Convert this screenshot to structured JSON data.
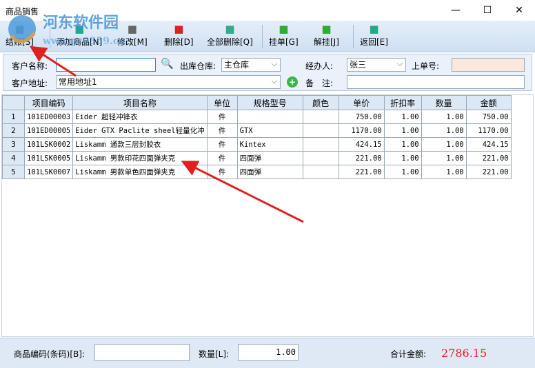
{
  "window": {
    "title": "商品销售",
    "minimize": "—",
    "maximize": "☐",
    "close": "✕"
  },
  "watermark": {
    "text": "河东软件园",
    "url": "www.pc0359.cn"
  },
  "toolbar": [
    {
      "label": "结账[S]",
      "icon": "save-icon",
      "color": "#8aa"
    },
    {
      "label": "添加商品[N]",
      "icon": "add-item-icon",
      "color": "#2a8"
    },
    {
      "label": "修改[M]",
      "icon": "edit-icon",
      "color": "#666"
    },
    {
      "label": "删除[D]",
      "icon": "delete-icon",
      "color": "#e02020"
    },
    {
      "label": "全部删除[Q]",
      "icon": "delete-all-icon",
      "color": "#3a8"
    },
    {
      "label": "挂单[G]",
      "icon": "hold-icon",
      "color": "#3a3"
    },
    {
      "label": "解挂[J]",
      "icon": "unhold-icon",
      "color": "#3a3"
    },
    {
      "label": "返回[E]",
      "icon": "exit-icon",
      "color": "#2a8"
    }
  ],
  "form": {
    "customer_name_label": "客户名称:",
    "customer_name": "",
    "warehouse_label": "出库仓库:",
    "warehouse": "主仓库",
    "handler_label": "经办人:",
    "handler": "张三",
    "prev_order_label": "上单号:",
    "prev_order": "",
    "address_label": "客户地址:",
    "address": "常用地址1",
    "remark_label": "备　注:",
    "remark": ""
  },
  "table": {
    "columns": [
      "",
      "项目编码",
      "项目名称",
      "单位",
      "规格型号",
      "颜色",
      "单价",
      "折扣率",
      "数量",
      "金额"
    ],
    "rows": [
      [
        "1",
        "101ED00003",
        "Eider 超轻冲锋衣",
        "件",
        "",
        "",
        "750.00",
        "1.00",
        "1.00",
        "750.00"
      ],
      [
        "2",
        "101ED00005",
        "Eider GTX Paclite sheel轻量化冲",
        "件",
        "GTX",
        "",
        "1170.00",
        "1.00",
        "1.00",
        "1170.00"
      ],
      [
        "3",
        "101LSK0002",
        "Liskamm 通款三层封胶衣",
        "件",
        "Kintex",
        "",
        "424.15",
        "1.00",
        "1.00",
        "424.15"
      ],
      [
        "4",
        "101LSK0005",
        "Liskamm 男款印花四面弹夹克",
        "件",
        "四面弹",
        "",
        "221.00",
        "1.00",
        "1.00",
        "221.00"
      ],
      [
        "5",
        "101LSK0007",
        "Liskamm 男款单色四面弹夹克",
        "件",
        "四面弹",
        "",
        "221.00",
        "1.00",
        "1.00",
        "221.00"
      ]
    ]
  },
  "bottom": {
    "barcode_label": "商品编码(条码)[B]:",
    "barcode": "",
    "qty_label": "数量[L]:",
    "qty": "1.00",
    "total_label": "合计金额:",
    "total": "2786.15"
  }
}
